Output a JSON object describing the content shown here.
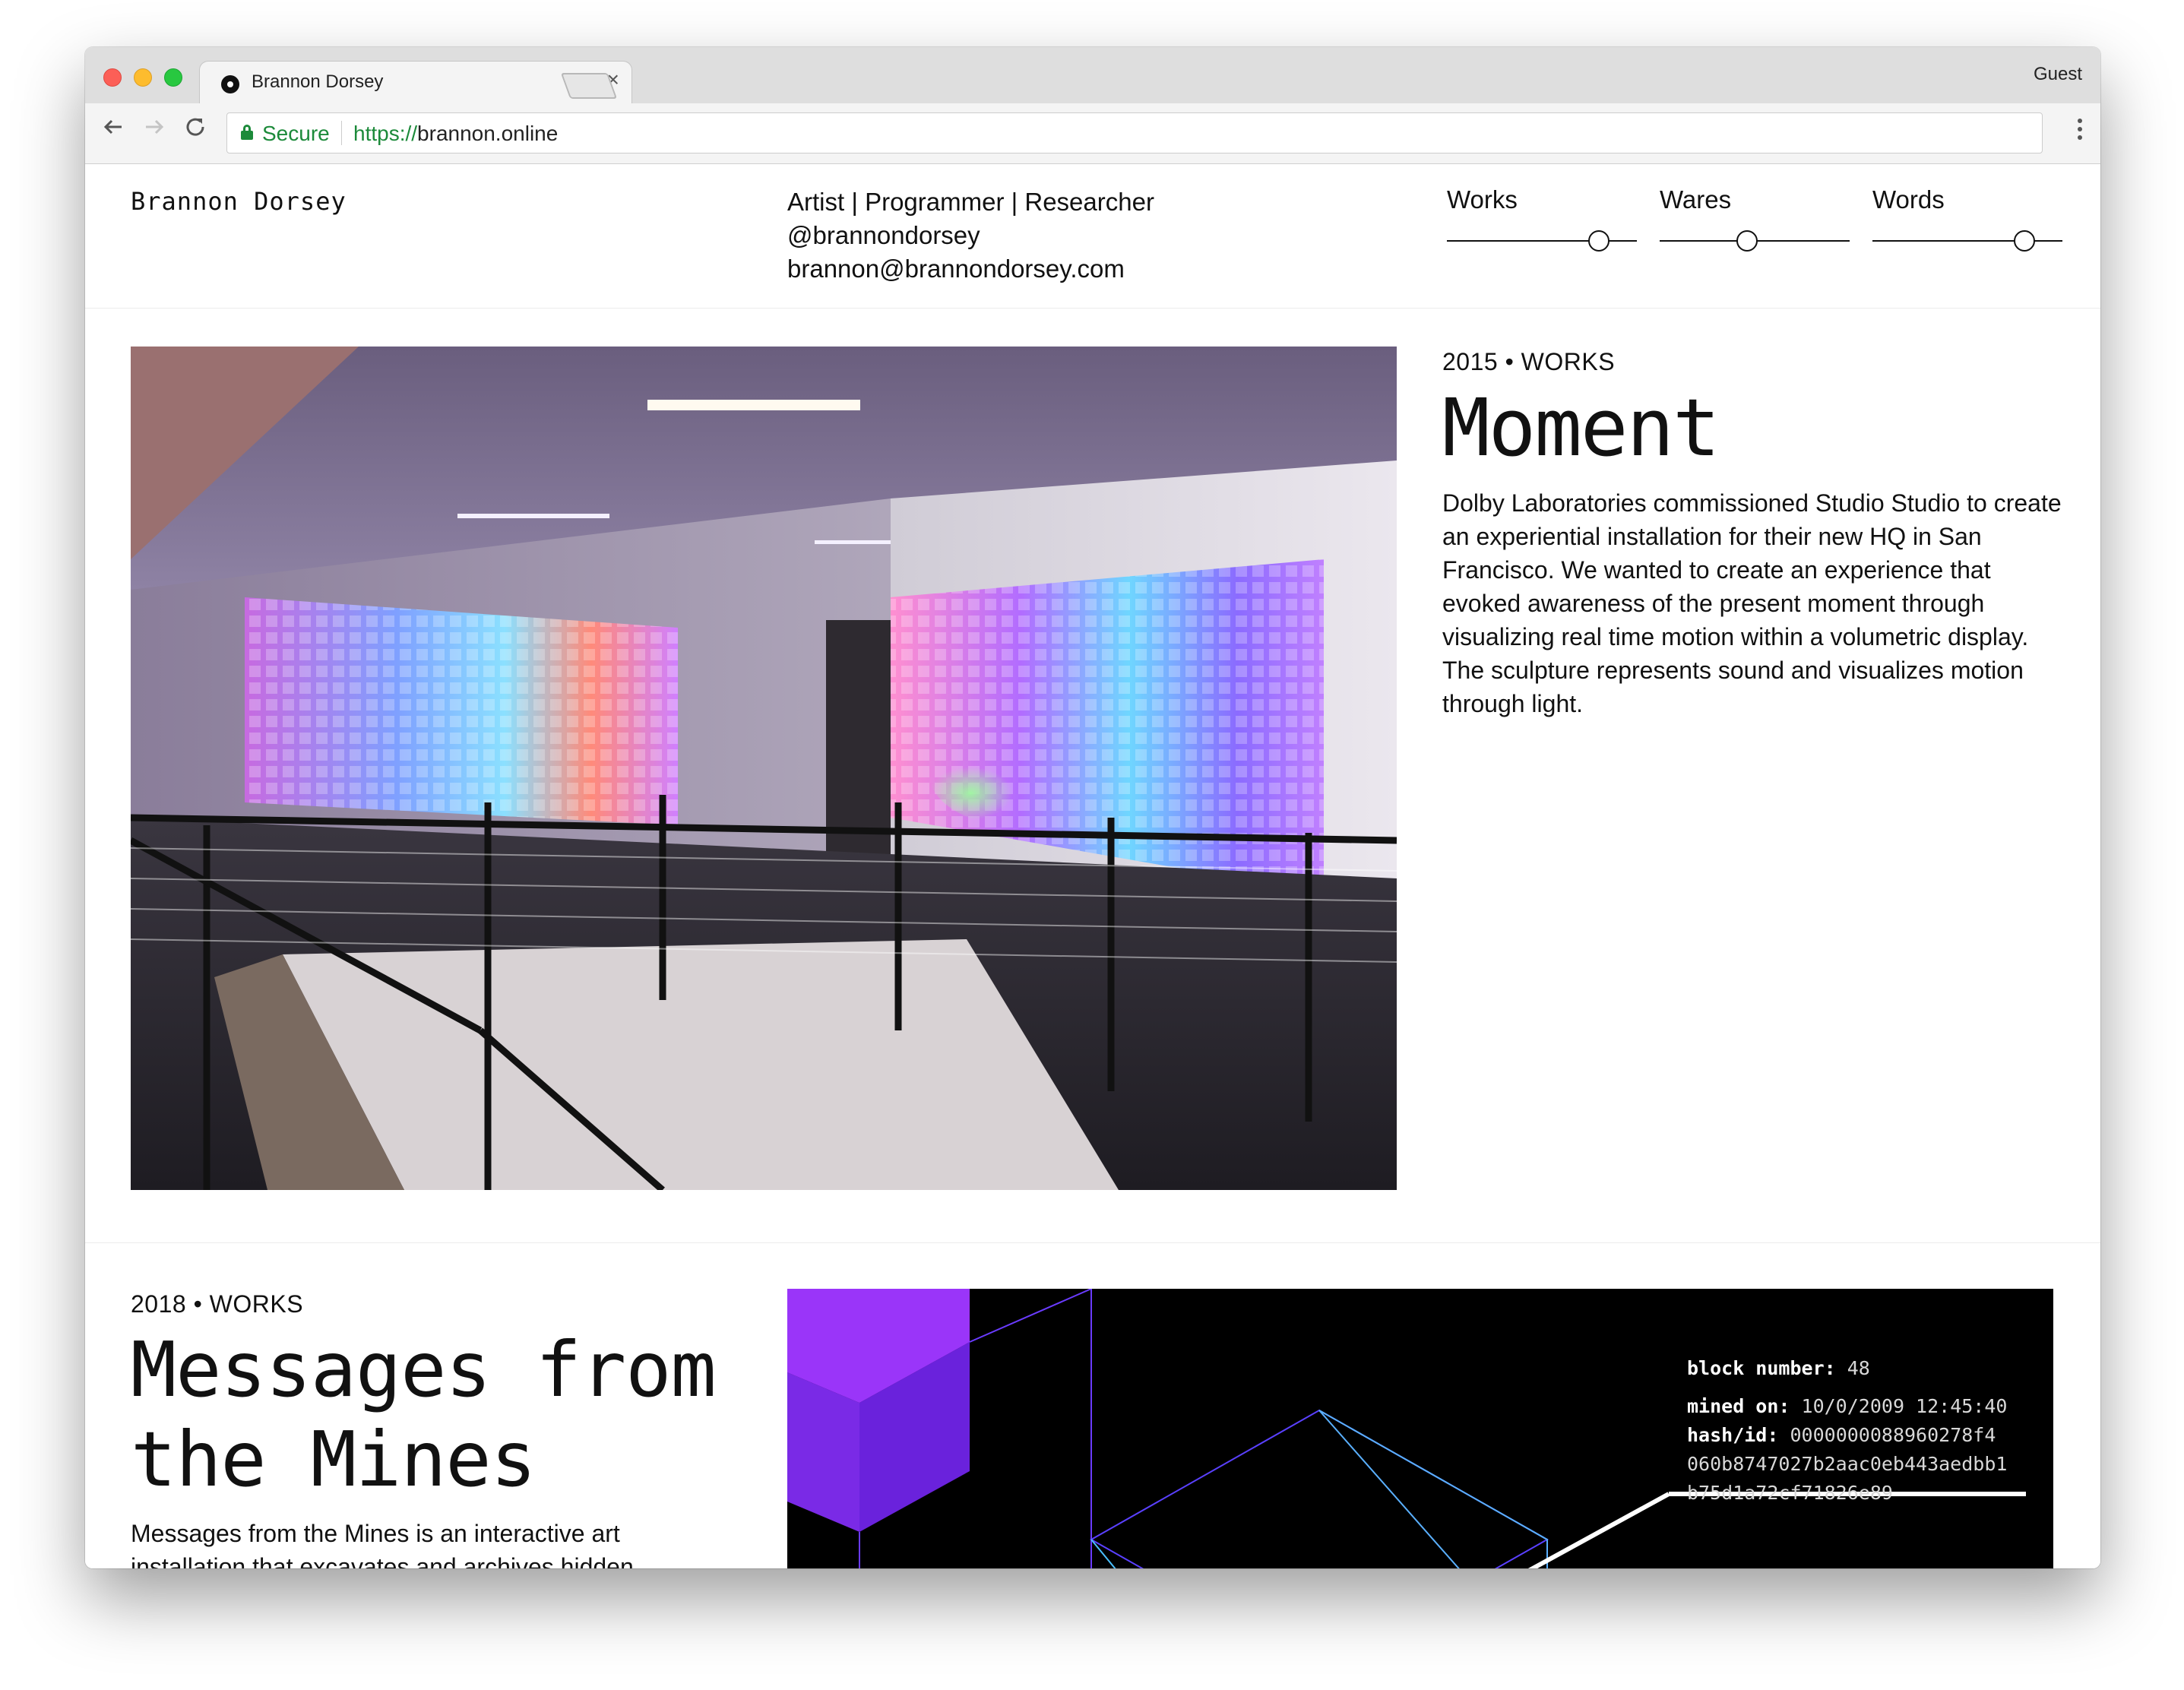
{
  "browser": {
    "tab_title": "Brannon Dorsey",
    "tab_close": "×",
    "profile": "Guest",
    "secure_label": "Secure",
    "url_scheme": "https://",
    "url_host": "brannon.online",
    "back_icon": "arrow-left-icon",
    "forward_icon": "arrow-right-icon",
    "reload_icon": "reload-icon"
  },
  "header": {
    "site_name": "Brannon Dorsey",
    "bio": {
      "roles": "Artist | Programmer | Researcher",
      "handle": "@brannondorsey",
      "email": "brannon@brannondorsey.com"
    },
    "filters": [
      {
        "label": "Works",
        "level": 0.8
      },
      {
        "label": "Wares",
        "level": 0.46
      },
      {
        "label": "Words",
        "level": 0.8
      }
    ]
  },
  "works": [
    {
      "meta": "2015 • WORKS",
      "title": "Moment",
      "description": "Dolby Laboratories commissioned Studio Studio to create an experiential installation for their new HQ in San Francisco. We wanted to create an experience that evoked awareness of the present moment through visualizing real time motion within a volumetric display. The sculpture represents sound and visualizes motion through light."
    },
    {
      "meta": "2018 • WORKS",
      "title": "Messages from the Mines",
      "description": "Messages from the Mines is an interactive art installation that excavates and archives hidden",
      "block": {
        "number_label": "block number:",
        "number_value": "48",
        "mined_label": "mined on:",
        "mined_value": "10/0/2009 12:45:40",
        "hash_label": "hash/id:",
        "hash_line1": "0000000088960278f4",
        "hash_line2": "060b8747027b2aac0eb443aedbb1",
        "hash_line3": "b75d1a72cf71826e89"
      }
    }
  ]
}
